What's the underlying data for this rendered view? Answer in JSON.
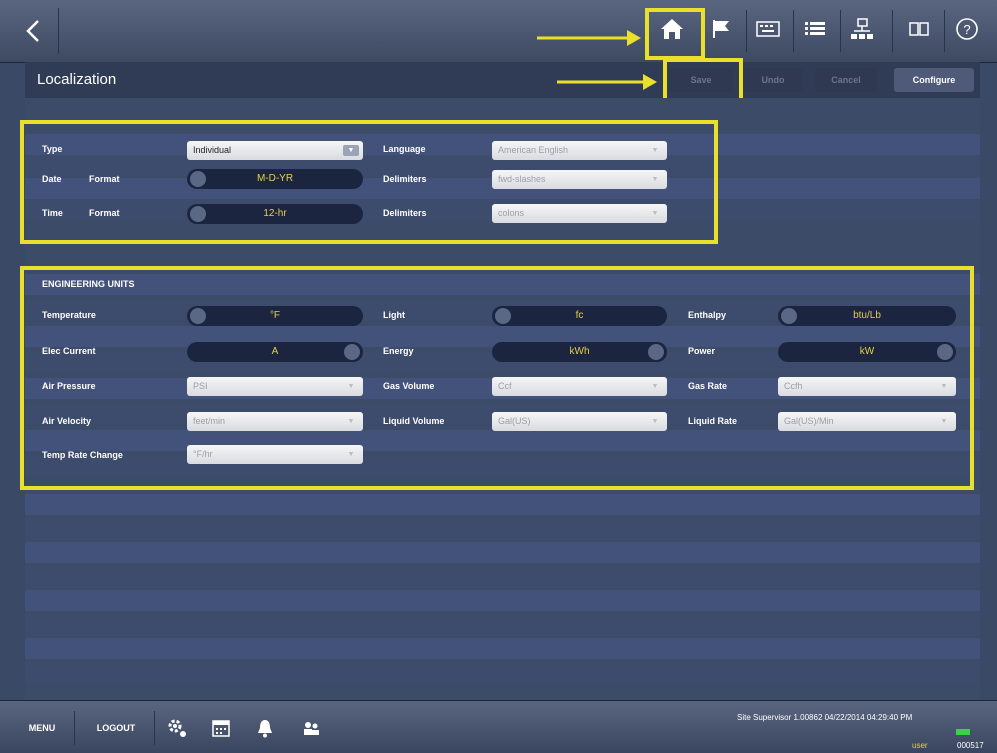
{
  "page": {
    "title": "Localization"
  },
  "toolbar": {
    "save": "Save",
    "undo": "Undo",
    "cancel": "Cancel",
    "configure": "Configure"
  },
  "top_icons": [
    "back-icon",
    "home-icon",
    "flag-icon",
    "keyboard-icon",
    "list-icon",
    "network-icon",
    "panels-icon",
    "help-icon"
  ],
  "general": {
    "type_label": "Type",
    "type_value": "Individual",
    "language_label": "Language",
    "language_value": "American English",
    "date_label": "Date",
    "date_format_label": "Format",
    "date_format_value": "M-D-YR",
    "date_delimiters_label": "Delimiters",
    "date_delimiters_value": "fwd-slashes",
    "time_label": "Time",
    "time_format_label": "Format",
    "time_format_value": "12-hr",
    "time_delimiters_label": "Delimiters",
    "time_delimiters_value": "colons"
  },
  "units": {
    "header": "ENGINEERING UNITS",
    "temperature_label": "Temperature",
    "temperature_value": "°F",
    "light_label": "Light",
    "light_value": "fc",
    "enthalpy_label": "Enthalpy",
    "enthalpy_value": "btu/Lb",
    "elec_current_label": "Elec Current",
    "elec_current_value": "A",
    "energy_label": "Energy",
    "energy_value": "kWh",
    "power_label": "Power",
    "power_value": "kW",
    "air_pressure_label": "Air Pressure",
    "air_pressure_value": "PSI",
    "gas_volume_label": "Gas Volume",
    "gas_volume_value": "Ccf",
    "gas_rate_label": "Gas Rate",
    "gas_rate_value": "Ccfh",
    "air_velocity_label": "Air Velocity",
    "air_velocity_value": "feet/min",
    "liquid_volume_label": "Liquid Volume",
    "liquid_volume_value": "Gal(US)",
    "liquid_rate_label": "Liquid Rate",
    "liquid_rate_value": "Gal(US)/Min",
    "temp_rate_label": "Temp Rate Change",
    "temp_rate_value": "°F/hr"
  },
  "bottom": {
    "menu": "MENU",
    "logout": "LOGOUT",
    "status": "Site Supervisor 1.00862 04/22/2014 04:29:40 PM",
    "user": "user",
    "code": "000517"
  },
  "colors": {
    "annotation": "#e8e02a",
    "toggle_text": "#e5cf4a"
  }
}
